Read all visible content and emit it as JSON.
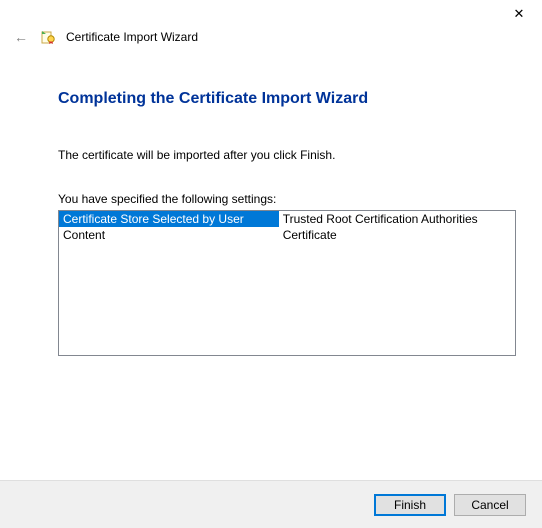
{
  "titlebar": {
    "close_glyph": "✕"
  },
  "header": {
    "back_glyph": "←",
    "title": "Certificate Import Wizard"
  },
  "page": {
    "heading": "Completing the Certificate Import Wizard",
    "info": "The certificate will be imported after you click Finish.",
    "settings_label": "You have specified the following settings:"
  },
  "settings": {
    "rows": [
      {
        "k": "Certificate Store Selected by User",
        "v": "Trusted Root Certification Authorities"
      },
      {
        "k": "Content",
        "v": "Certificate"
      }
    ]
  },
  "footer": {
    "finish": "Finish",
    "cancel": "Cancel"
  }
}
